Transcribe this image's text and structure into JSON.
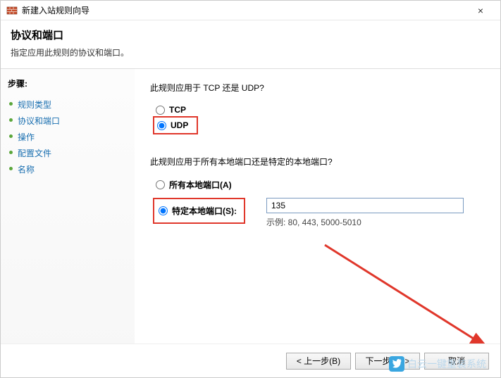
{
  "window": {
    "title": "新建入站规则向导",
    "close": "×"
  },
  "header": {
    "title": "协议和端口",
    "subtitle": "指定应用此规则的协议和端口。"
  },
  "sidebar": {
    "label": "步骤:",
    "items": [
      {
        "label": "规则类型"
      },
      {
        "label": "协议和端口"
      },
      {
        "label": "操作"
      },
      {
        "label": "配置文件"
      },
      {
        "label": "名称"
      }
    ]
  },
  "main": {
    "q1": "此规则应用于 TCP 还是 UDP?",
    "protocol": {
      "tcp": "TCP",
      "udp": "UDP",
      "selected": "udp"
    },
    "q2": "此规则应用于所有本地端口还是特定的本地端口?",
    "ports": {
      "all_label": "所有本地端口(A)",
      "specific_label": "特定本地端口(S):",
      "selected": "specific",
      "value": "135",
      "example": "示例: 80, 443, 5000-5010"
    }
  },
  "footer": {
    "back": "< 上一步(B)",
    "next": "下一步(N) >",
    "cancel": "取消"
  },
  "watermark": "白云一键重装系统"
}
